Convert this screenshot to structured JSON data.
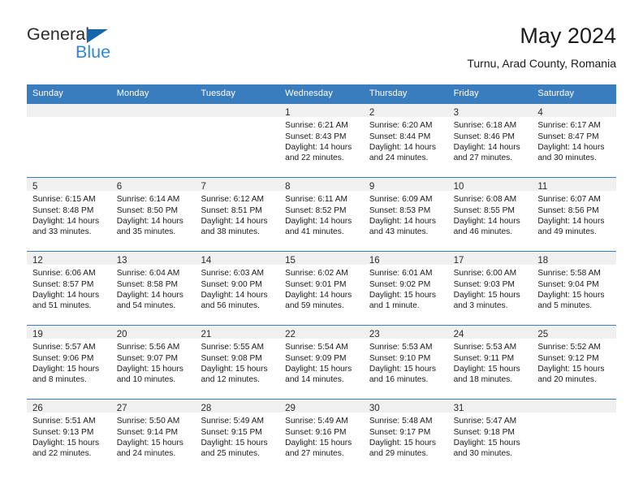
{
  "brand": {
    "word_general": "General",
    "word_blue": "Blue",
    "triangle_color": "#1565a8",
    "blue_text_color": "#2f88d4"
  },
  "header": {
    "title": "May 2024",
    "subtitle": "Turnu, Arad County, Romania"
  },
  "theme": {
    "header_blue": "#3a7dbf",
    "daynum_band": "#f0f0f0",
    "text": "#1a1a1a"
  },
  "weekdays": [
    "Sunday",
    "Monday",
    "Tuesday",
    "Wednesday",
    "Thursday",
    "Friday",
    "Saturday"
  ],
  "weeks": [
    [
      {
        "day": "",
        "sunrise": "",
        "sunset": "",
        "daylight1": "",
        "daylight2": ""
      },
      {
        "day": "",
        "sunrise": "",
        "sunset": "",
        "daylight1": "",
        "daylight2": ""
      },
      {
        "day": "",
        "sunrise": "",
        "sunset": "",
        "daylight1": "",
        "daylight2": ""
      },
      {
        "day": "1",
        "sunrise": "Sunrise: 6:21 AM",
        "sunset": "Sunset: 8:43 PM",
        "daylight1": "Daylight: 14 hours",
        "daylight2": "and 22 minutes."
      },
      {
        "day": "2",
        "sunrise": "Sunrise: 6:20 AM",
        "sunset": "Sunset: 8:44 PM",
        "daylight1": "Daylight: 14 hours",
        "daylight2": "and 24 minutes."
      },
      {
        "day": "3",
        "sunrise": "Sunrise: 6:18 AM",
        "sunset": "Sunset: 8:46 PM",
        "daylight1": "Daylight: 14 hours",
        "daylight2": "and 27 minutes."
      },
      {
        "day": "4",
        "sunrise": "Sunrise: 6:17 AM",
        "sunset": "Sunset: 8:47 PM",
        "daylight1": "Daylight: 14 hours",
        "daylight2": "and 30 minutes."
      }
    ],
    [
      {
        "day": "5",
        "sunrise": "Sunrise: 6:15 AM",
        "sunset": "Sunset: 8:48 PM",
        "daylight1": "Daylight: 14 hours",
        "daylight2": "and 33 minutes."
      },
      {
        "day": "6",
        "sunrise": "Sunrise: 6:14 AM",
        "sunset": "Sunset: 8:50 PM",
        "daylight1": "Daylight: 14 hours",
        "daylight2": "and 35 minutes."
      },
      {
        "day": "7",
        "sunrise": "Sunrise: 6:12 AM",
        "sunset": "Sunset: 8:51 PM",
        "daylight1": "Daylight: 14 hours",
        "daylight2": "and 38 minutes."
      },
      {
        "day": "8",
        "sunrise": "Sunrise: 6:11 AM",
        "sunset": "Sunset: 8:52 PM",
        "daylight1": "Daylight: 14 hours",
        "daylight2": "and 41 minutes."
      },
      {
        "day": "9",
        "sunrise": "Sunrise: 6:09 AM",
        "sunset": "Sunset: 8:53 PM",
        "daylight1": "Daylight: 14 hours",
        "daylight2": "and 43 minutes."
      },
      {
        "day": "10",
        "sunrise": "Sunrise: 6:08 AM",
        "sunset": "Sunset: 8:55 PM",
        "daylight1": "Daylight: 14 hours",
        "daylight2": "and 46 minutes."
      },
      {
        "day": "11",
        "sunrise": "Sunrise: 6:07 AM",
        "sunset": "Sunset: 8:56 PM",
        "daylight1": "Daylight: 14 hours",
        "daylight2": "and 49 minutes."
      }
    ],
    [
      {
        "day": "12",
        "sunrise": "Sunrise: 6:06 AM",
        "sunset": "Sunset: 8:57 PM",
        "daylight1": "Daylight: 14 hours",
        "daylight2": "and 51 minutes."
      },
      {
        "day": "13",
        "sunrise": "Sunrise: 6:04 AM",
        "sunset": "Sunset: 8:58 PM",
        "daylight1": "Daylight: 14 hours",
        "daylight2": "and 54 minutes."
      },
      {
        "day": "14",
        "sunrise": "Sunrise: 6:03 AM",
        "sunset": "Sunset: 9:00 PM",
        "daylight1": "Daylight: 14 hours",
        "daylight2": "and 56 minutes."
      },
      {
        "day": "15",
        "sunrise": "Sunrise: 6:02 AM",
        "sunset": "Sunset: 9:01 PM",
        "daylight1": "Daylight: 14 hours",
        "daylight2": "and 59 minutes."
      },
      {
        "day": "16",
        "sunrise": "Sunrise: 6:01 AM",
        "sunset": "Sunset: 9:02 PM",
        "daylight1": "Daylight: 15 hours",
        "daylight2": "and 1 minute."
      },
      {
        "day": "17",
        "sunrise": "Sunrise: 6:00 AM",
        "sunset": "Sunset: 9:03 PM",
        "daylight1": "Daylight: 15 hours",
        "daylight2": "and 3 minutes."
      },
      {
        "day": "18",
        "sunrise": "Sunrise: 5:58 AM",
        "sunset": "Sunset: 9:04 PM",
        "daylight1": "Daylight: 15 hours",
        "daylight2": "and 5 minutes."
      }
    ],
    [
      {
        "day": "19",
        "sunrise": "Sunrise: 5:57 AM",
        "sunset": "Sunset: 9:06 PM",
        "daylight1": "Daylight: 15 hours",
        "daylight2": "and 8 minutes."
      },
      {
        "day": "20",
        "sunrise": "Sunrise: 5:56 AM",
        "sunset": "Sunset: 9:07 PM",
        "daylight1": "Daylight: 15 hours",
        "daylight2": "and 10 minutes."
      },
      {
        "day": "21",
        "sunrise": "Sunrise: 5:55 AM",
        "sunset": "Sunset: 9:08 PM",
        "daylight1": "Daylight: 15 hours",
        "daylight2": "and 12 minutes."
      },
      {
        "day": "22",
        "sunrise": "Sunrise: 5:54 AM",
        "sunset": "Sunset: 9:09 PM",
        "daylight1": "Daylight: 15 hours",
        "daylight2": "and 14 minutes."
      },
      {
        "day": "23",
        "sunrise": "Sunrise: 5:53 AM",
        "sunset": "Sunset: 9:10 PM",
        "daylight1": "Daylight: 15 hours",
        "daylight2": "and 16 minutes."
      },
      {
        "day": "24",
        "sunrise": "Sunrise: 5:53 AM",
        "sunset": "Sunset: 9:11 PM",
        "daylight1": "Daylight: 15 hours",
        "daylight2": "and 18 minutes."
      },
      {
        "day": "25",
        "sunrise": "Sunrise: 5:52 AM",
        "sunset": "Sunset: 9:12 PM",
        "daylight1": "Daylight: 15 hours",
        "daylight2": "and 20 minutes."
      }
    ],
    [
      {
        "day": "26",
        "sunrise": "Sunrise: 5:51 AM",
        "sunset": "Sunset: 9:13 PM",
        "daylight1": "Daylight: 15 hours",
        "daylight2": "and 22 minutes."
      },
      {
        "day": "27",
        "sunrise": "Sunrise: 5:50 AM",
        "sunset": "Sunset: 9:14 PM",
        "daylight1": "Daylight: 15 hours",
        "daylight2": "and 24 minutes."
      },
      {
        "day": "28",
        "sunrise": "Sunrise: 5:49 AM",
        "sunset": "Sunset: 9:15 PM",
        "daylight1": "Daylight: 15 hours",
        "daylight2": "and 25 minutes."
      },
      {
        "day": "29",
        "sunrise": "Sunrise: 5:49 AM",
        "sunset": "Sunset: 9:16 PM",
        "daylight1": "Daylight: 15 hours",
        "daylight2": "and 27 minutes."
      },
      {
        "day": "30",
        "sunrise": "Sunrise: 5:48 AM",
        "sunset": "Sunset: 9:17 PM",
        "daylight1": "Daylight: 15 hours",
        "daylight2": "and 29 minutes."
      },
      {
        "day": "31",
        "sunrise": "Sunrise: 5:47 AM",
        "sunset": "Sunset: 9:18 PM",
        "daylight1": "Daylight: 15 hours",
        "daylight2": "and 30 minutes."
      },
      {
        "day": "",
        "sunrise": "",
        "sunset": "",
        "daylight1": "",
        "daylight2": ""
      }
    ]
  ]
}
